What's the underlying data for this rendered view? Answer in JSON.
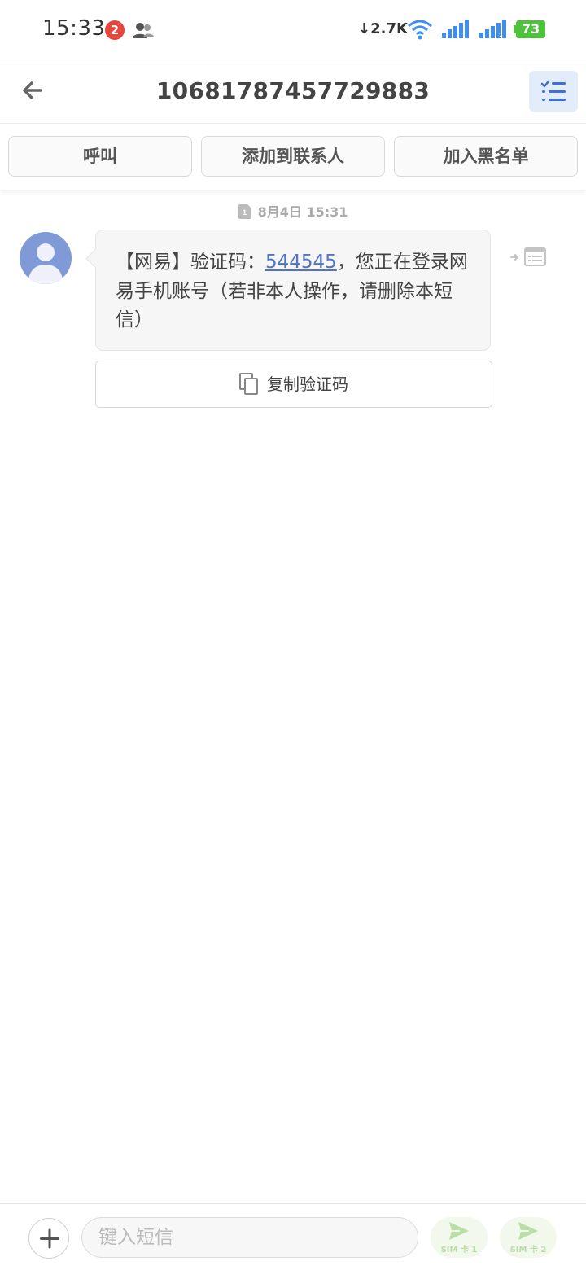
{
  "status_bar": {
    "time": "15:33",
    "notification_count": "2",
    "net_speed": "2.7K",
    "battery_level": "73",
    "battery_color": "#4fc23c"
  },
  "header": {
    "title": "10681787457729883"
  },
  "actions": {
    "call": "呼叫",
    "add_contact": "添加到联系人",
    "blacklist": "加入黑名单"
  },
  "conversation": {
    "date": "8月4日 15:31",
    "message": {
      "prefix": "【网易】验证码：",
      "code": "544545",
      "suffix": "，您正在登录网易手机账号（若非本人操作，请删除本短信）"
    },
    "copy_code_label": "复制验证码"
  },
  "input_bar": {
    "placeholder": "键入短信",
    "send_sim1": "SIM 卡 1",
    "send_sim2": "SIM 卡 2"
  },
  "colors": {
    "accent": "#4f73c7",
    "avatar_bg": "#7f9ad6",
    "list_button_bg": "#e3ecfb"
  }
}
